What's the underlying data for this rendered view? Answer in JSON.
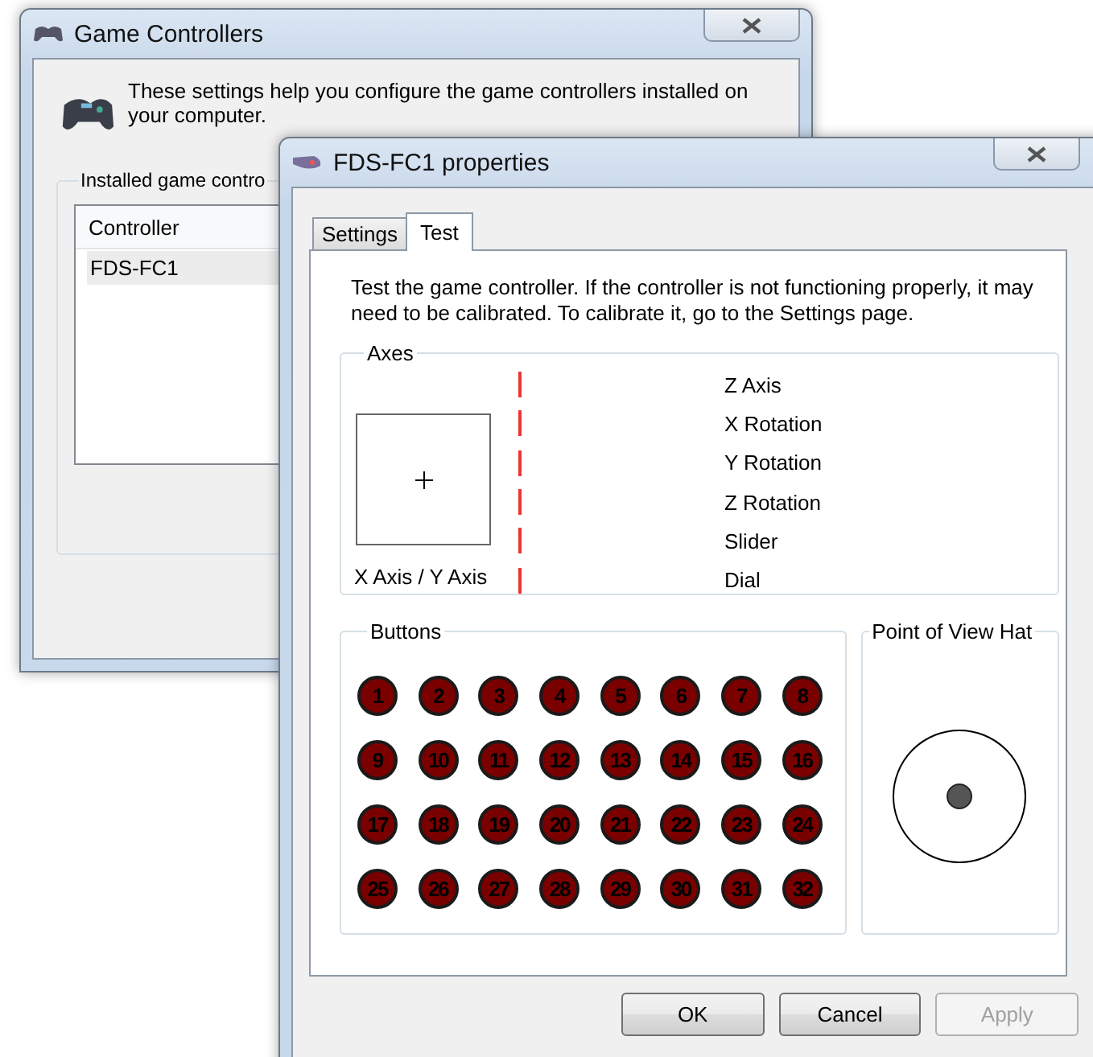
{
  "back_window": {
    "title": "Game Controllers",
    "intro": "These settings help you configure the game controllers installed on your computer.",
    "group_label": "Installed game contro",
    "list": {
      "columns": [
        "Controller"
      ],
      "rows": [
        {
          "name": "FDS-FC1",
          "selected": true
        }
      ]
    }
  },
  "properties_window": {
    "title": "FDS-FC1 properties",
    "tabs": [
      {
        "label": "Settings",
        "selected": false
      },
      {
        "label": "Test",
        "selected": true
      }
    ],
    "description": "Test the game controller.  If the controller is not functioning properly, it may need to be calibrated.  To calibrate it, go to the Settings page.",
    "axes": {
      "label": "Axes",
      "xy_label": "X Axis / Y Axis",
      "items": [
        "Z Axis",
        "X Rotation",
        "Y Rotation",
        "Z Rotation",
        "Slider",
        "Dial"
      ]
    },
    "buttons_group": {
      "label": "Buttons",
      "items": [
        "1",
        "2",
        "3",
        "4",
        "5",
        "6",
        "7",
        "8",
        "9",
        "10",
        "11",
        "12",
        "13",
        "14",
        "15",
        "16",
        "17",
        "18",
        "19",
        "20",
        "21",
        "22",
        "23",
        "24",
        "25",
        "26",
        "27",
        "28",
        "29",
        "30",
        "31",
        "32"
      ]
    },
    "pov": {
      "label": "Point of View Hat"
    },
    "actions": [
      {
        "label": "OK",
        "disabled": false
      },
      {
        "label": "Cancel",
        "disabled": false
      },
      {
        "label": "Apply",
        "disabled": true
      }
    ]
  }
}
